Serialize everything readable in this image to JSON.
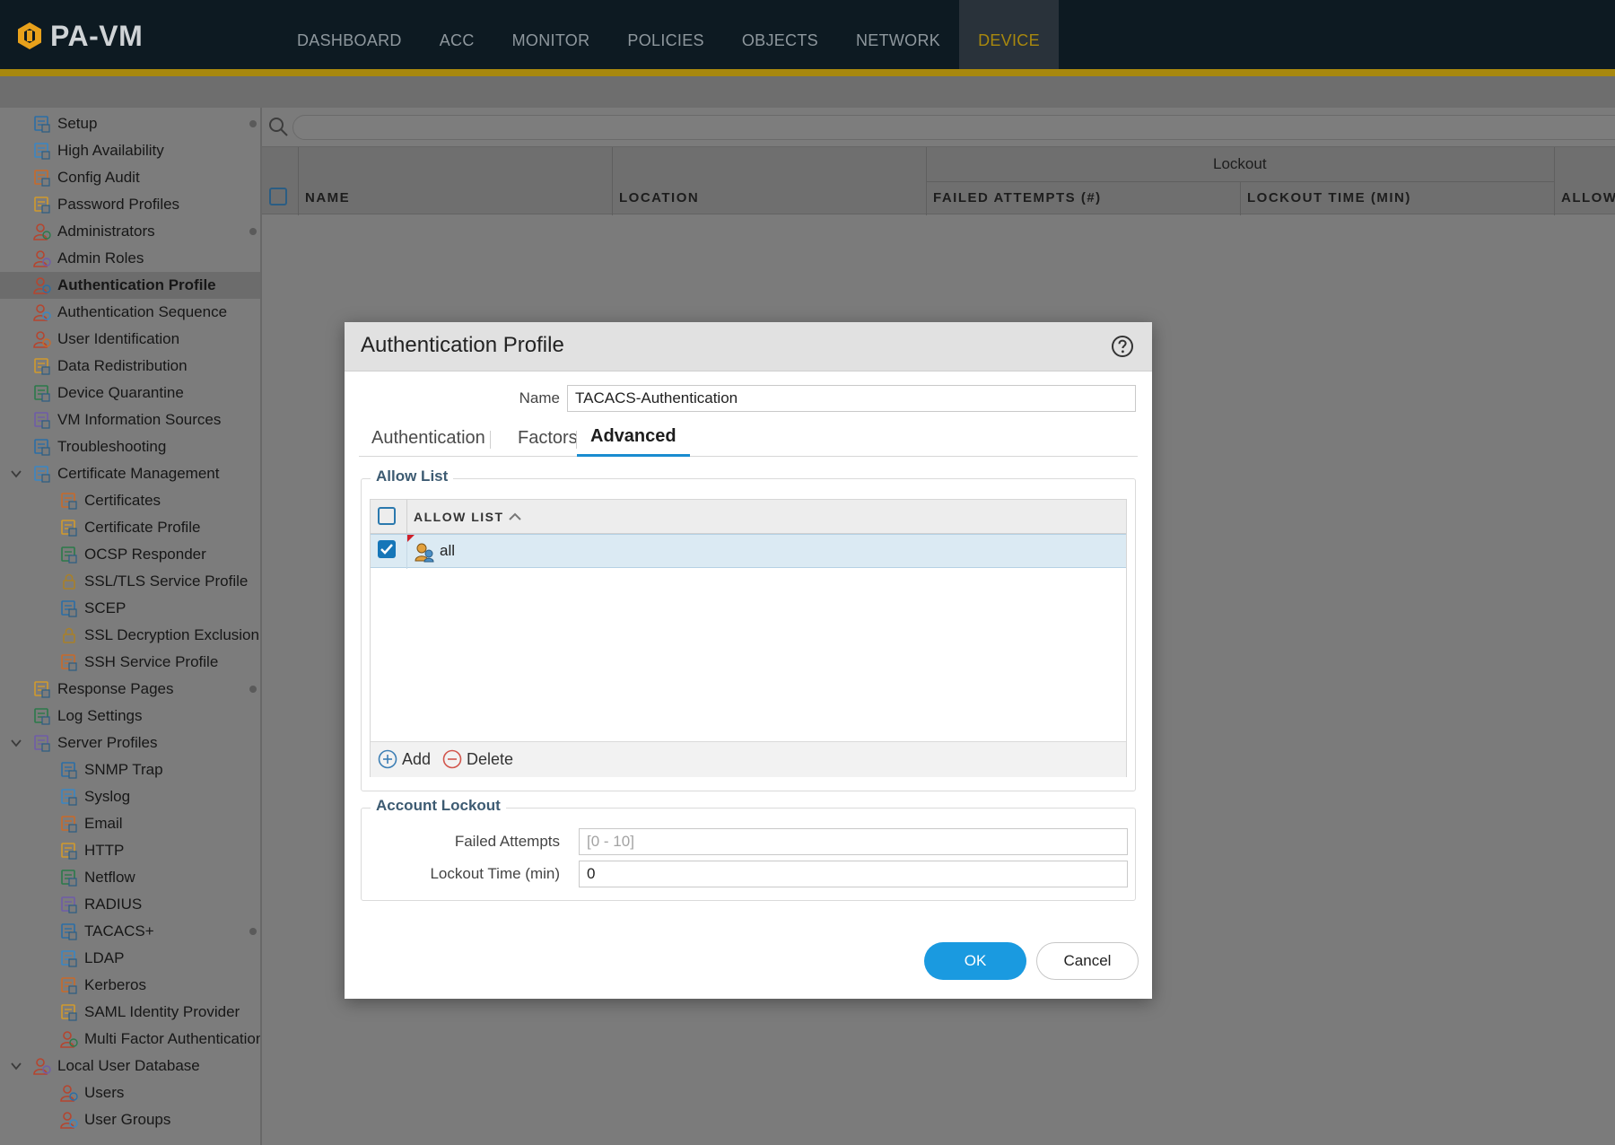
{
  "app": {
    "name": "PA-VM"
  },
  "nav": {
    "tabs": [
      "DASHBOARD",
      "ACC",
      "MONITOR",
      "POLICIES",
      "OBJECTS",
      "NETWORK",
      "DEVICE"
    ],
    "active": "DEVICE"
  },
  "sidebar": {
    "items": [
      {
        "label": "Setup",
        "icon": "setup-icon",
        "dot": true
      },
      {
        "label": "High Availability",
        "icon": "high-availability-icon"
      },
      {
        "label": "Config Audit",
        "icon": "config-audit-icon"
      },
      {
        "label": "Password Profiles",
        "icon": "password-profiles-icon"
      },
      {
        "label": "Administrators",
        "icon": "administrators-icon",
        "dot": true
      },
      {
        "label": "Admin Roles",
        "icon": "admin-roles-icon"
      },
      {
        "label": "Authentication Profile",
        "icon": "authentication-profile-icon",
        "selected": true
      },
      {
        "label": "Authentication Sequence",
        "icon": "authentication-sequence-icon"
      },
      {
        "label": "User Identification",
        "icon": "user-identification-icon"
      },
      {
        "label": "Data Redistribution",
        "icon": "data-redistribution-icon"
      },
      {
        "label": "Device Quarantine",
        "icon": "device-quarantine-icon"
      },
      {
        "label": "VM Information Sources",
        "icon": "vm-information-sources-icon"
      },
      {
        "label": "Troubleshooting",
        "icon": "troubleshooting-icon"
      },
      {
        "label": "Certificate Management",
        "icon": "certificate-management-icon",
        "expanded": true
      },
      {
        "label": "Certificates",
        "icon": "certificates-icon",
        "child": true
      },
      {
        "label": "Certificate Profile",
        "icon": "certificate-profile-icon",
        "child": true
      },
      {
        "label": "OCSP Responder",
        "icon": "ocsp-responder-icon",
        "child": true
      },
      {
        "label": "SSL/TLS Service Profile",
        "icon": "lock-icon",
        "child": true
      },
      {
        "label": "SCEP",
        "icon": "scep-icon",
        "child": true
      },
      {
        "label": "SSL Decryption Exclusion",
        "icon": "lock-icon",
        "child": true
      },
      {
        "label": "SSH Service Profile",
        "icon": "ssh-service-profile-icon",
        "child": true
      },
      {
        "label": "Response Pages",
        "icon": "response-pages-icon",
        "dot": true
      },
      {
        "label": "Log Settings",
        "icon": "log-settings-icon"
      },
      {
        "label": "Server Profiles",
        "icon": "server-profiles-icon",
        "expanded": true
      },
      {
        "label": "SNMP Trap",
        "icon": "snmp-trap-icon",
        "child": true
      },
      {
        "label": "Syslog",
        "icon": "syslog-icon",
        "child": true
      },
      {
        "label": "Email",
        "icon": "email-icon",
        "child": true
      },
      {
        "label": "HTTP",
        "icon": "http-icon",
        "child": true
      },
      {
        "label": "Netflow",
        "icon": "netflow-icon",
        "child": true
      },
      {
        "label": "RADIUS",
        "icon": "radius-icon",
        "child": true
      },
      {
        "label": "TACACS+",
        "icon": "tacacs-icon",
        "child": true,
        "dot": true
      },
      {
        "label": "LDAP",
        "icon": "ldap-icon",
        "child": true
      },
      {
        "label": "Kerberos",
        "icon": "kerberos-icon",
        "child": true
      },
      {
        "label": "SAML Identity Provider",
        "icon": "saml-identity-provider-icon",
        "child": true
      },
      {
        "label": "Multi Factor Authentication",
        "icon": "multi-factor-authentication-icon",
        "child": true
      },
      {
        "label": "Local User Database",
        "icon": "local-user-database-icon",
        "expanded": true
      },
      {
        "label": "Users",
        "icon": "users-icon",
        "child": true
      },
      {
        "label": "User Groups",
        "icon": "user-groups-icon",
        "child": true
      }
    ]
  },
  "table": {
    "columns": {
      "name": "NAME",
      "location": "LOCATION",
      "lockout_group": "Lockout",
      "failed_attempts": "FAILED ATTEMPTS (#)",
      "lockout_time": "LOCKOUT TIME (MIN)",
      "allow": "ALLOW"
    }
  },
  "dialog": {
    "title": "Authentication Profile",
    "name_label": "Name",
    "name_value": "TACACS-Authentication",
    "tabs": [
      "Authentication",
      "Factors",
      "Advanced"
    ],
    "active_tab": "Advanced",
    "allow_list": {
      "legend": "Allow List",
      "column": "ALLOW LIST",
      "rows": [
        {
          "value": "all",
          "checked": true
        }
      ],
      "add_label": "Add",
      "delete_label": "Delete"
    },
    "account_lockout": {
      "legend": "Account Lockout",
      "failed_attempts_label": "Failed Attempts",
      "failed_attempts_placeholder": "[0 - 10]",
      "lockout_time_label": "Lockout Time (min)",
      "lockout_time_value": "0"
    },
    "ok_label": "OK",
    "cancel_label": "Cancel"
  },
  "colors": {
    "accent": "#a8880e",
    "primary_button": "#1a9ae0",
    "selection": "#dbeaf3",
    "header_bg": "#0d1a22"
  }
}
